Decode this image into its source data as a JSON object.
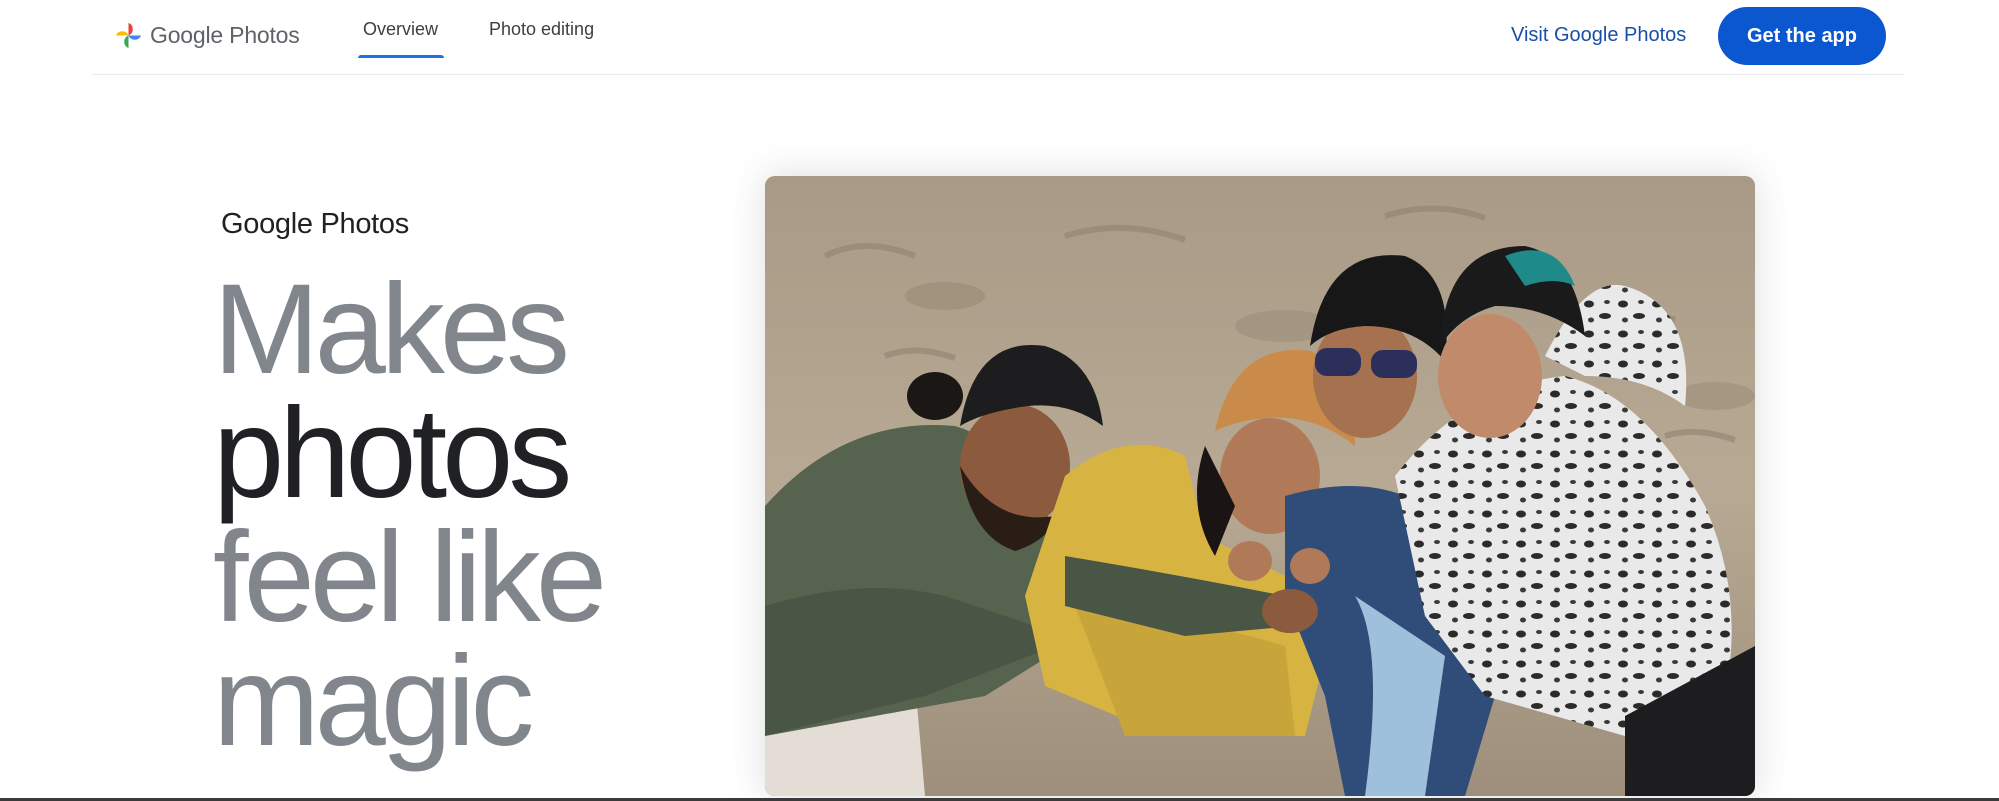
{
  "header": {
    "logo": {
      "brand": "Google",
      "product": "Photos",
      "icon": "google-photos-pinwheel-icon"
    },
    "tabs": [
      {
        "label": "Overview",
        "active": true
      },
      {
        "label": "Photo editing",
        "active": false
      }
    ],
    "visit_link": "Visit Google Photos",
    "cta_button": "Get the app"
  },
  "hero": {
    "brand": "Google Photos",
    "headline": [
      "Makes",
      "photos",
      "feel like",
      "magic"
    ],
    "photo": {
      "subject": "group-hug-on-beach-photo"
    }
  },
  "colors": {
    "accent": "#1a73e8",
    "cta_background": "#0b57d0",
    "headline_grey": "#80868b",
    "headline_dark": "#202124"
  }
}
